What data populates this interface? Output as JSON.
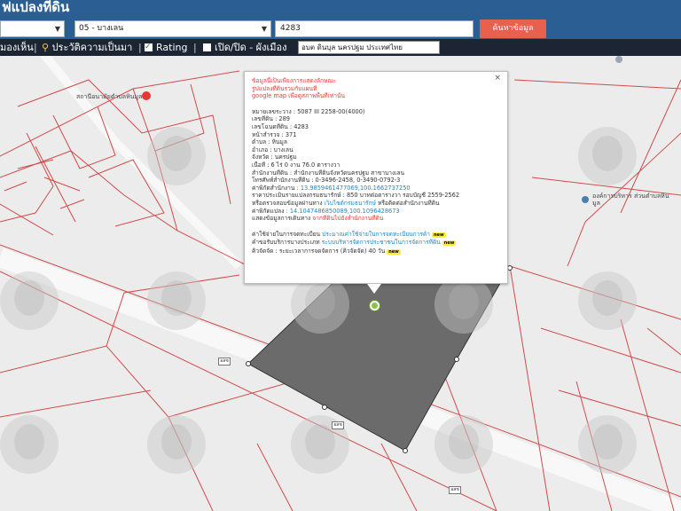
{
  "header": {
    "title": "ฟแปลงที่ดิน"
  },
  "search": {
    "province_value": "",
    "district_value": "05 - บางเลน",
    "parcel_value": "4283",
    "search_button": "ค้นหาข้อมูล"
  },
  "toolbar": {
    "item1": "มองเห็น",
    "item2": "ประวัติความเป็นมา",
    "item3": "Rating",
    "item4": "เปิด/ปิด - ผังเมือง",
    "location_value": "อบต ดินบุล นครปฐม ประเทศไทย"
  },
  "map": {
    "poi1": "สถานีอนามัยตำบลหินมูล",
    "poi2": "องค์การบริหาร ส่วนตำบลหินมูล",
    "road_signs": [
      "อสช",
      "อสช",
      "อสช"
    ]
  },
  "popup": {
    "notice_lines": [
      "ข้อมูลนี้เป็นเพียงการแสดงลักษณะ",
      "รูปแปลงที่ดินรวมกับแผนที่",
      "google map เพื่อดูสภาพพื้นที่เท่านั้น"
    ],
    "fields": [
      {
        "label": "หมายเลขระวาง",
        "value": ": 5087 III 2258-00(4000)"
      },
      {
        "label": "เลขที่ดิน",
        "value": ": 289"
      },
      {
        "label": "เลขโฉนดที่ดิน",
        "value": ": 4283"
      },
      {
        "label": "หน้าสำรวจ",
        "value": ": 371"
      },
      {
        "label": "ตำบล",
        "value": ": หินมูล"
      },
      {
        "label": "อำเภอ",
        "value": ": บางเลน"
      },
      {
        "label": "จังหวัด",
        "value": ": นครปฐม"
      },
      {
        "label": "เนื้อที่",
        "value": ": 6 ไร่ 0 งาน 76.0 ตารางวา"
      },
      {
        "label": "สำนักงานที่ดิน",
        "value": ": สำนักงานที่ดินจังหวัดนครปฐม สาขาบางเลน"
      },
      {
        "label": "โทรศัพท์สำนักงานที่ดิน",
        "value": ": 0-3496-2458, 0-3490-0792-3"
      }
    ],
    "office_coord_label": "ค่าพิกัดสำนักงาน",
    "office_coord_value": ": 13.9859461477069,100.1662737250",
    "price_line": "ราคาประเมินรายแปลงกรมธนารักษ์ : 850 บาทต่อตารางวา รอบบัญชี 2559-2562",
    "check_line_prefix": "หรือตรวจสอบข้อมูลผ่านทาง",
    "check_line_link": "เว็บไซต์กรมธนารักษ์",
    "check_line_suffix": "หรือติดต่อสำนักงานที่ดิน",
    "parcel_coord_label": "ค่าพิกัดแปลง",
    "parcel_coord_value": ": 14.1047486850089,100.1096428673",
    "source_label": "แสดงข้อมูลการเดินทาง",
    "source_link": "จากที่ดินไปยังสำนักงานที่ดิน",
    "reg_label": "ค่าใช้จ่ายในการจดทะเบียน",
    "reg_link": "ประมาณค่าใช้จ่ายในการจดทะเบียนการค้า",
    "reg_badge": "new",
    "service_label": "คำขอรับบริการบางประเภท",
    "service_link": "ระบบบริหารจัดการประชาชนในการจัดการที่ดิน",
    "service_badge": "new",
    "queue_line": "คิวจัดจัด : ระยะเวลาการจดจัดการ (คิวจัดจัด) 40 วัน",
    "queue_badge": "new",
    "close_symbol": "×"
  },
  "colors": {
    "header_bg": "#2b5f93",
    "toolbar_bg": "#1c2533",
    "search_button": "#e7614e",
    "parcel_fill": "#6b6b6b",
    "parcel_lines": "#d24b4b"
  }
}
